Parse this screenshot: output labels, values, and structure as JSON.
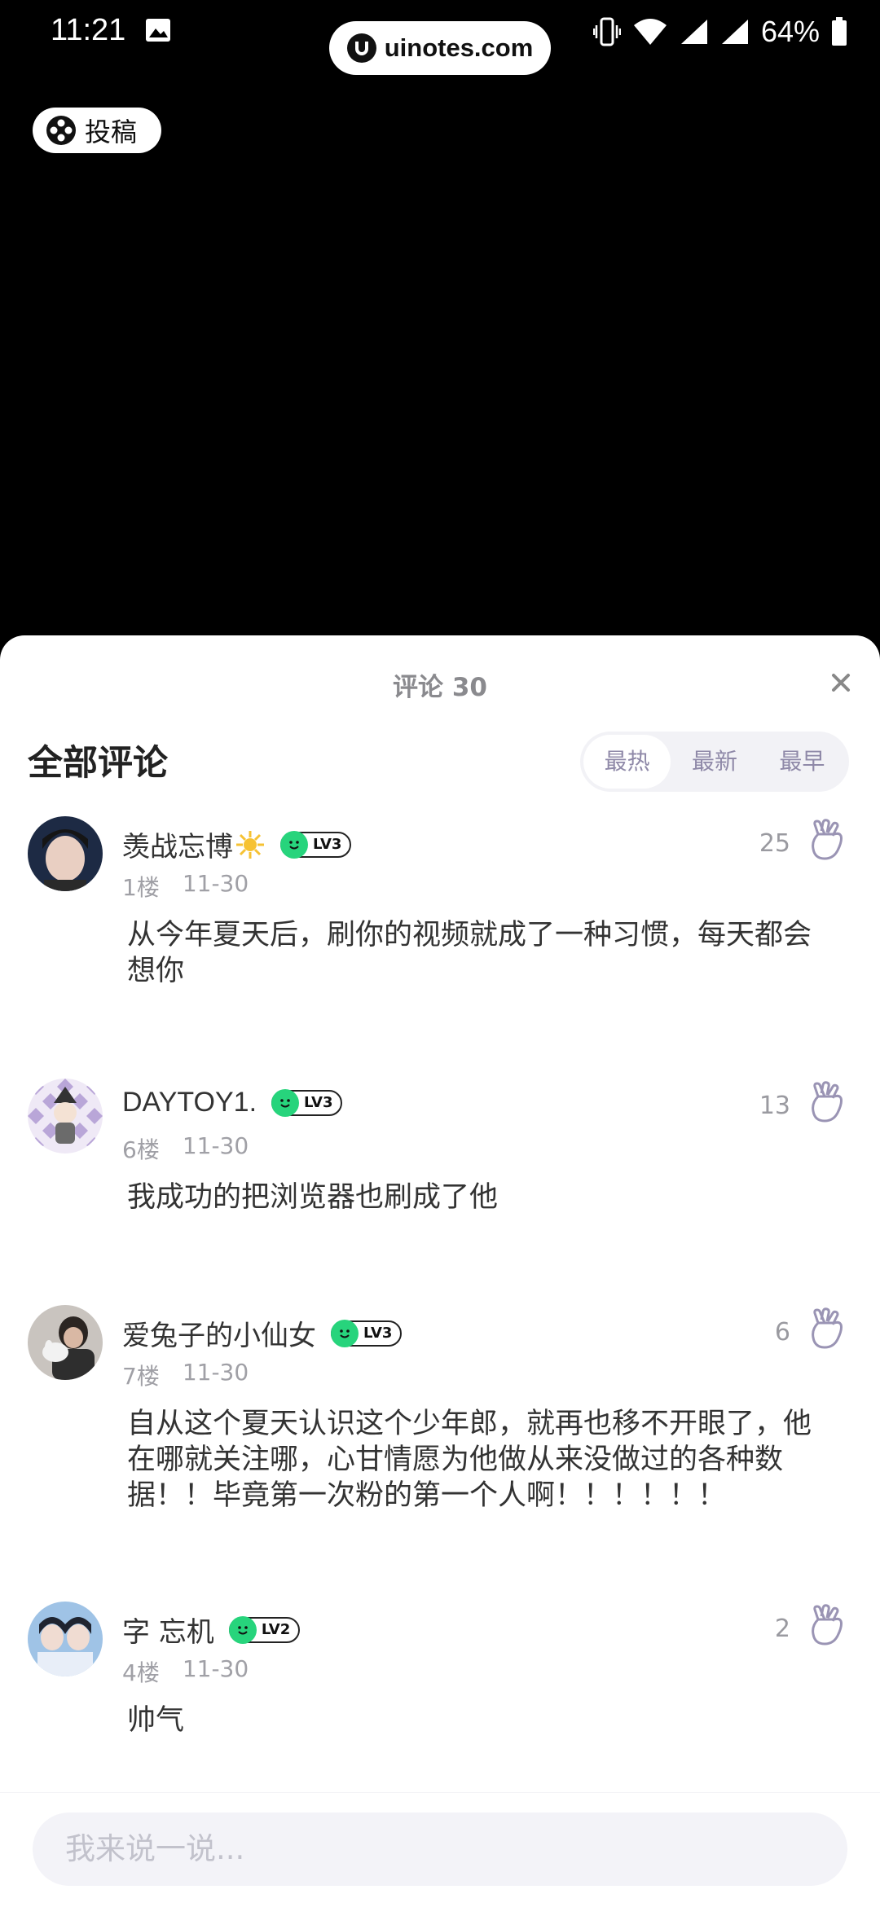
{
  "status_bar": {
    "time": "11:21",
    "battery": "64%"
  },
  "watermark": {
    "text": "uinotes.com"
  },
  "submit_button": {
    "label": "投稿"
  },
  "sheet": {
    "title": "评论 30",
    "section_title": "全部评论",
    "sort_tabs": [
      {
        "label": "最热",
        "active": true
      },
      {
        "label": "最新",
        "active": false
      },
      {
        "label": "最早",
        "active": false
      }
    ]
  },
  "comments": [
    {
      "username": "羡战忘博",
      "level": "LV3",
      "floor": "1楼",
      "date": "11-30",
      "likes": "25",
      "text": "从今年夏天后，刷你的视频就成了一种习惯，每天都会想你"
    },
    {
      "username": "DAYTOY1.",
      "level": "LV3",
      "floor": "6楼",
      "date": "11-30",
      "likes": "13",
      "text": "我成功的把浏览器也刷成了他"
    },
    {
      "username": "爱兔子的小仙女",
      "level": "LV3",
      "floor": "7楼",
      "date": "11-30",
      "likes": "6",
      "text": "自从这个夏天认识这个少年郎，就再也移不开眼了，他在哪就关注哪，心甘情愿为他做从来没做过的各种数据！！毕竟第一次粉的第一个人啊！！！！！！"
    },
    {
      "username": "字 忘机",
      "level": "LV2",
      "floor": "4楼",
      "date": "11-30",
      "likes": "2",
      "text": "帅气"
    }
  ],
  "input": {
    "placeholder": "我来说一说..."
  },
  "colors": {
    "accent_text": "#8f89a8",
    "level_green": "#27d47c"
  }
}
